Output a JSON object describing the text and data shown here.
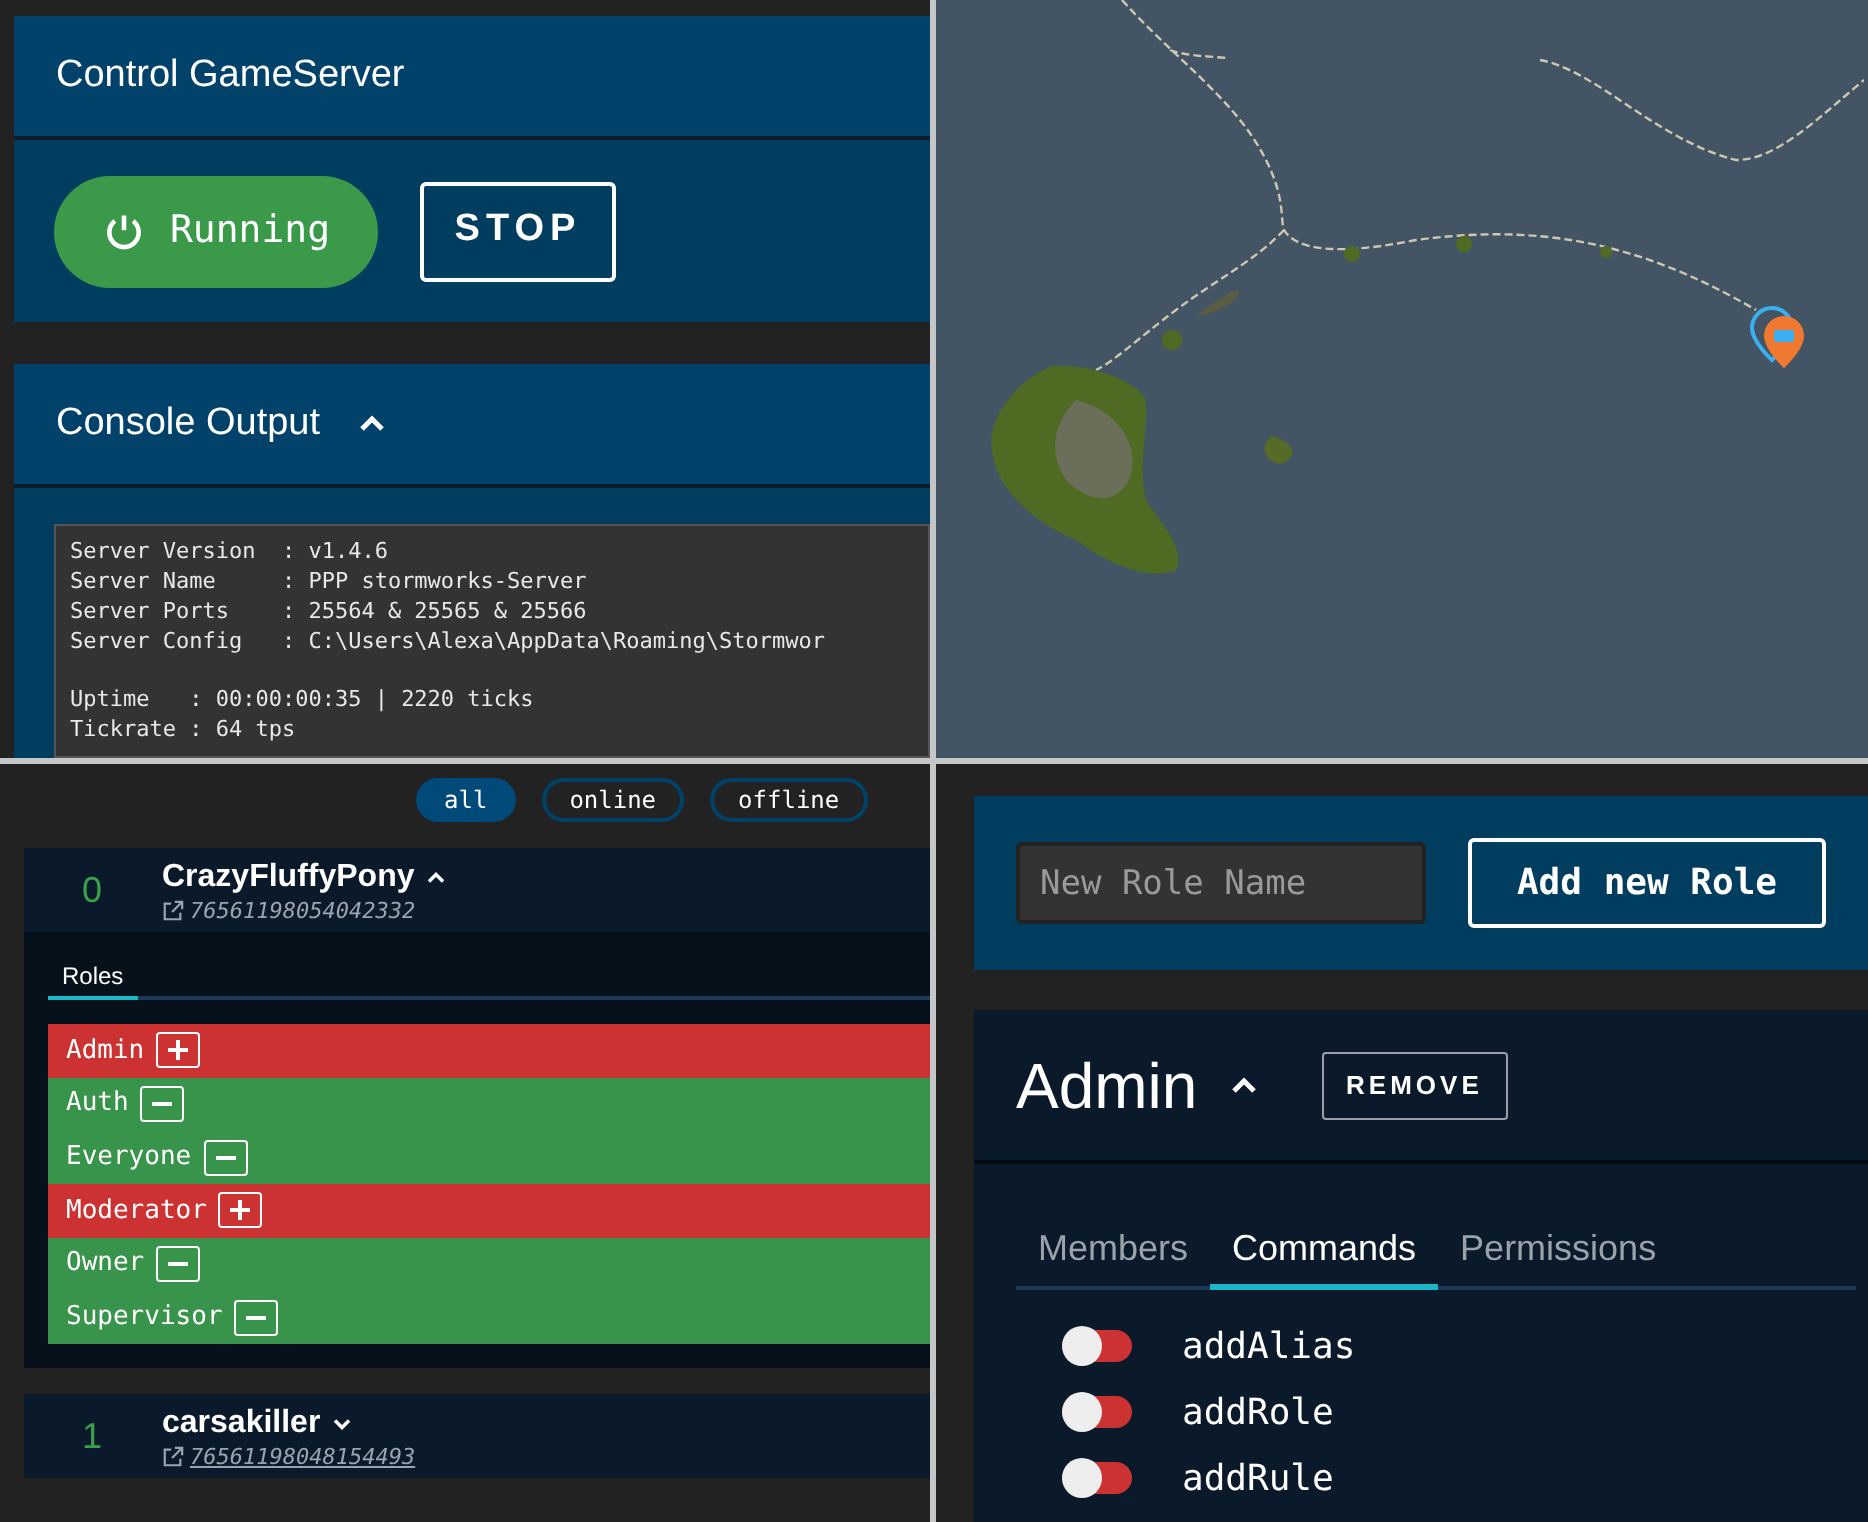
{
  "control_panel": {
    "title": "Control GameServer",
    "status": {
      "label": "Running",
      "running": true
    },
    "stop_button": "STOP"
  },
  "console": {
    "title": "Console Output",
    "expanded": true,
    "blocks": [
      [
        "Server Version  : v1.4.6",
        "Server Name     : PPP stormworks-Server",
        "Server Ports    : 25564 & 25565 & 25566",
        "Server Config   : C:\\Users\\Alexa\\AppData\\Roaming\\Stormwor"
      ],
      [
        "Uptime   : 00:00:00:35 | 2220 ticks",
        "Tickrate : 64 tps"
      ]
    ]
  },
  "players": {
    "filters": [
      {
        "label": "all",
        "selected": true
      },
      {
        "label": "online",
        "selected": false
      },
      {
        "label": "offline",
        "selected": false
      }
    ],
    "list": [
      {
        "index": "0",
        "name": "CrazyFluffyPony",
        "expanded": true,
        "steam_id": "76561198054042332",
        "tabs": [
          {
            "label": "Roles",
            "selected": true
          }
        ],
        "roles": [
          {
            "name": "Admin",
            "assigned": false
          },
          {
            "name": "Auth",
            "assigned": true
          },
          {
            "name": "Everyone",
            "assigned": true
          },
          {
            "name": "Moderator",
            "assigned": false
          },
          {
            "name": "Owner",
            "assigned": true
          },
          {
            "name": "Supervisor",
            "assigned": true
          }
        ]
      },
      {
        "index": "1",
        "name": "carsakiller",
        "expanded": false,
        "steam_id": "76561198048154493"
      }
    ]
  },
  "roles_panel": {
    "new_role": {
      "placeholder": "New Role Name"
    },
    "add_button": "Add new Role",
    "role": {
      "name": "Admin",
      "expanded": true,
      "remove_button": "REMOVE",
      "tabs": [
        {
          "label": "Members",
          "selected": false
        },
        {
          "label": "Commands",
          "selected": true
        },
        {
          "label": "Permissions",
          "selected": false
        }
      ],
      "commands": [
        {
          "name": "addAlias",
          "on": false
        },
        {
          "name": "addRole",
          "on": false
        },
        {
          "name": "addRule",
          "on": false
        }
      ]
    }
  }
}
